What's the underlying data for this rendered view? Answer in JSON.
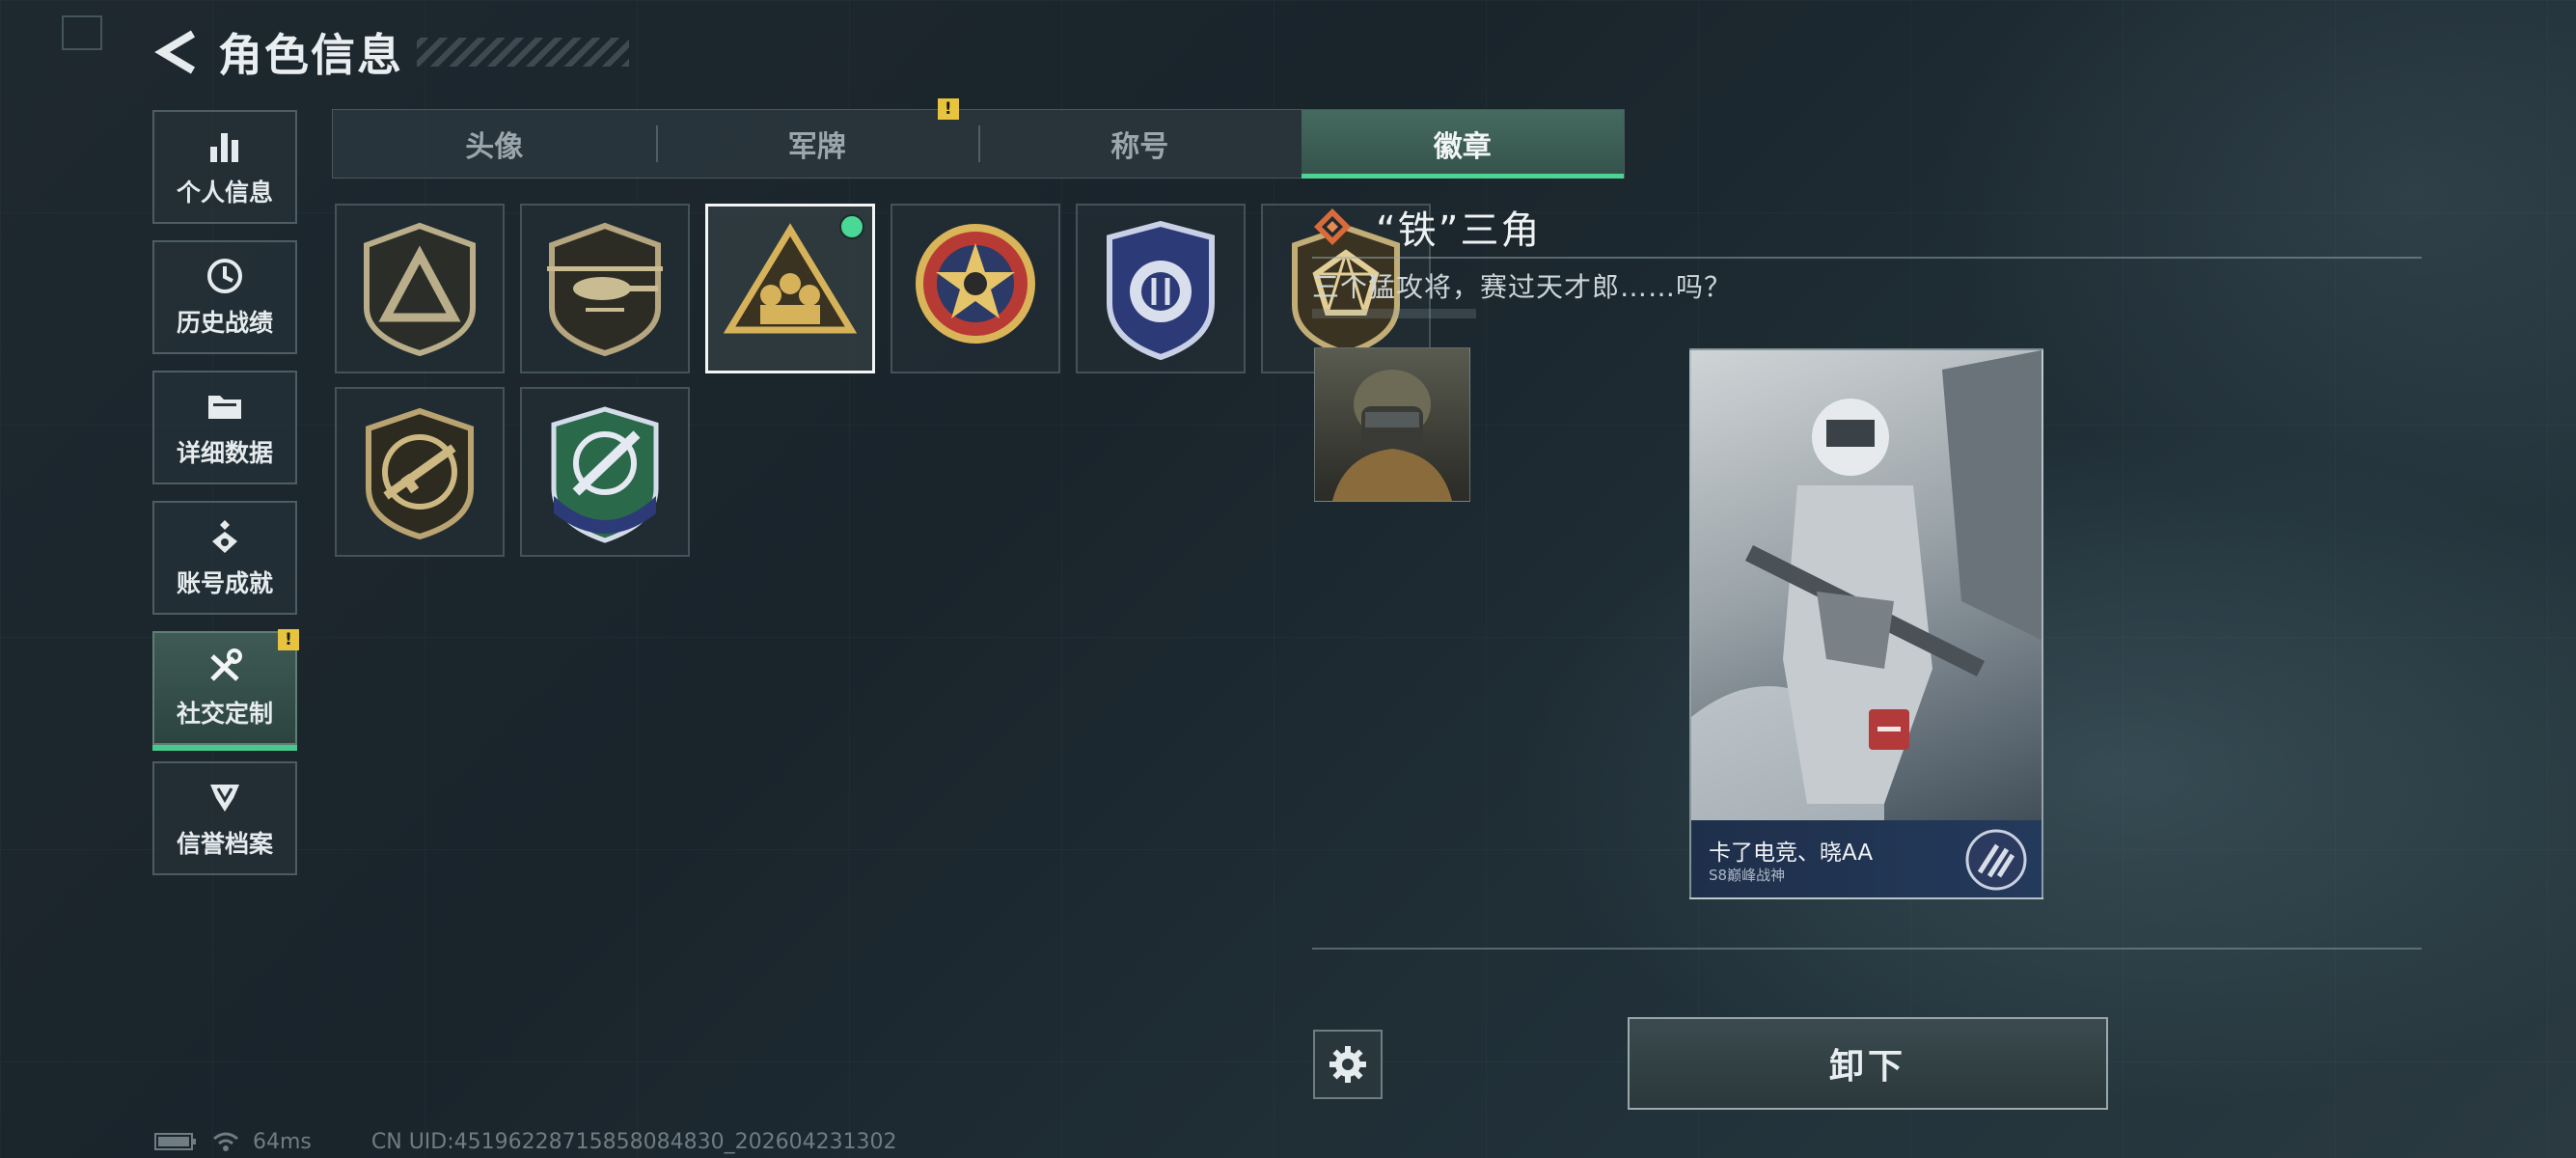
{
  "header": {
    "title": "角色信息"
  },
  "sidebar": {
    "items": [
      {
        "label": "个人信息",
        "icon": "bar-chart-icon",
        "active": false,
        "alert": ""
      },
      {
        "label": "历史战绩",
        "icon": "clock-history-icon",
        "active": false,
        "alert": ""
      },
      {
        "label": "详细数据",
        "icon": "folder-icon",
        "active": false,
        "alert": ""
      },
      {
        "label": "账号成就",
        "icon": "achievement-icon",
        "active": false,
        "alert": ""
      },
      {
        "label": "社交定制",
        "icon": "tools-icon",
        "active": true,
        "alert": "!"
      },
      {
        "label": "信誉档案",
        "icon": "credit-shield-icon",
        "active": false,
        "alert": ""
      }
    ]
  },
  "tabs": [
    {
      "label": "头像",
      "active": false,
      "alert": ""
    },
    {
      "label": "军牌",
      "active": false,
      "alert": "!"
    },
    {
      "label": "称号",
      "active": false,
      "alert": ""
    },
    {
      "label": "徽章",
      "active": true,
      "alert": ""
    }
  ],
  "badges": [
    {
      "name": "triangle-badge",
      "selected": false,
      "equipped": false
    },
    {
      "name": "helicopter-badge",
      "selected": false,
      "equipped": false
    },
    {
      "name": "iron-triangle-badge",
      "selected": true,
      "equipped": true
    },
    {
      "name": "star-skull-badge",
      "selected": false,
      "equipped": false
    },
    {
      "name": "blue-shield-badge",
      "selected": false,
      "equipped": false
    },
    {
      "name": "gem-badge",
      "selected": false,
      "equipped": false
    },
    {
      "name": "rifle-badge",
      "selected": false,
      "equipped": false
    },
    {
      "name": "crosshair-knife-badge",
      "selected": false,
      "equipped": false
    }
  ],
  "detail": {
    "name": "“铁”三角",
    "description": "三个猛攻将，赛过天才郎……吗？"
  },
  "card": {
    "player_name": "卡了电竞、晓AA",
    "rank": "S8巅峰战神"
  },
  "actions": {
    "unequip_label": "卸下"
  },
  "status": {
    "ping": "64ms",
    "uid": "CN UID:4519622871585808​4830_202604231302"
  },
  "colors": {
    "accent_green": "#4fd394",
    "alert_yellow": "#e8c43e",
    "remove_red": "#b33a3a"
  }
}
